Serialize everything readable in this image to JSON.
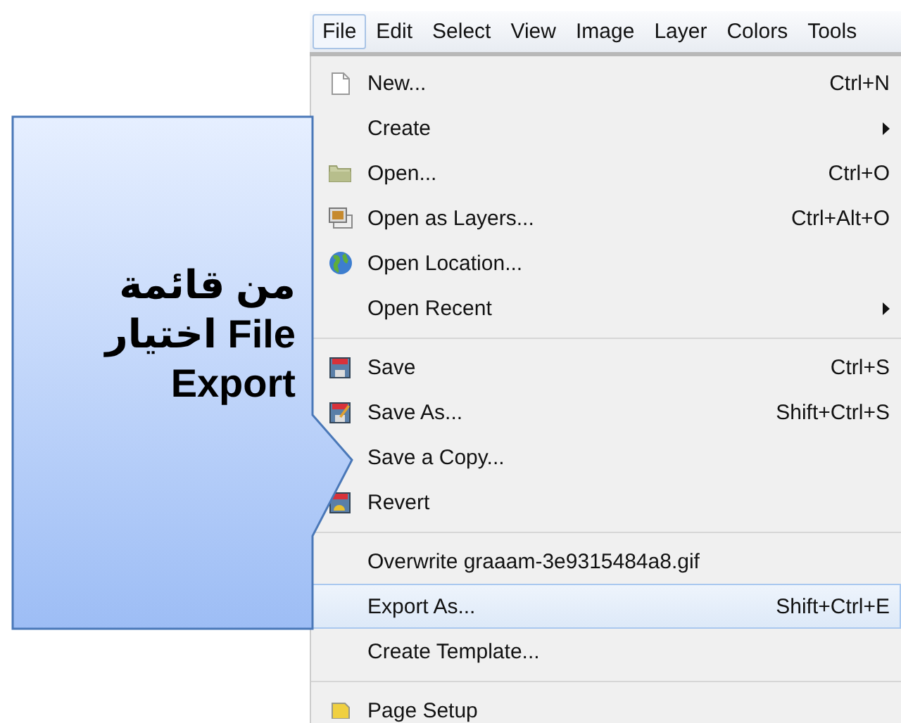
{
  "menubar": [
    {
      "label": "File",
      "selected": true
    },
    {
      "label": "Edit",
      "selected": false
    },
    {
      "label": "Select",
      "selected": false
    },
    {
      "label": "View",
      "selected": false
    },
    {
      "label": "Image",
      "selected": false
    },
    {
      "label": "Layer",
      "selected": false
    },
    {
      "label": "Colors",
      "selected": false
    },
    {
      "label": "Tools",
      "selected": false
    }
  ],
  "menu": [
    {
      "kind": "item",
      "label": "New...",
      "shortcut": "Ctrl+N",
      "submenu": false,
      "selected": false
    },
    {
      "kind": "item",
      "label": "Create",
      "submenu": true,
      "selected": false
    },
    {
      "kind": "item",
      "label": "Open...",
      "shortcut": "Ctrl+O",
      "submenu": false,
      "selected": false
    },
    {
      "kind": "item",
      "label": "Open as Layers...",
      "shortcut": "Ctrl+Alt+O",
      "submenu": false,
      "selected": false
    },
    {
      "kind": "item",
      "label": "Open Location...",
      "submenu": false,
      "selected": false
    },
    {
      "kind": "item",
      "label": "Open Recent",
      "submenu": true,
      "selected": false
    },
    {
      "kind": "separator"
    },
    {
      "kind": "item",
      "label": "Save",
      "shortcut": "Ctrl+S",
      "submenu": false,
      "selected": false
    },
    {
      "kind": "item",
      "label": "Save As...",
      "shortcut": "Shift+Ctrl+S",
      "submenu": false,
      "selected": false
    },
    {
      "kind": "item",
      "label": "Save a Copy...",
      "submenu": false,
      "selected": false
    },
    {
      "kind": "item",
      "label": "Revert",
      "submenu": false,
      "selected": false
    },
    {
      "kind": "separator"
    },
    {
      "kind": "item",
      "label": "Overwrite graaam-3e9315484a8.gif",
      "submenu": false,
      "selected": false
    },
    {
      "kind": "item",
      "label": "Export As...",
      "shortcut": "Shift+Ctrl+E",
      "submenu": false,
      "selected": true
    },
    {
      "kind": "item",
      "label": "Create Template...",
      "submenu": false,
      "selected": false
    },
    {
      "kind": "separator"
    },
    {
      "kind": "item",
      "label": "Page Setup",
      "submenu": false,
      "selected": false
    }
  ],
  "callout": {
    "lines": [
      "من قائمة",
      "File اختيار",
      "Export"
    ]
  }
}
